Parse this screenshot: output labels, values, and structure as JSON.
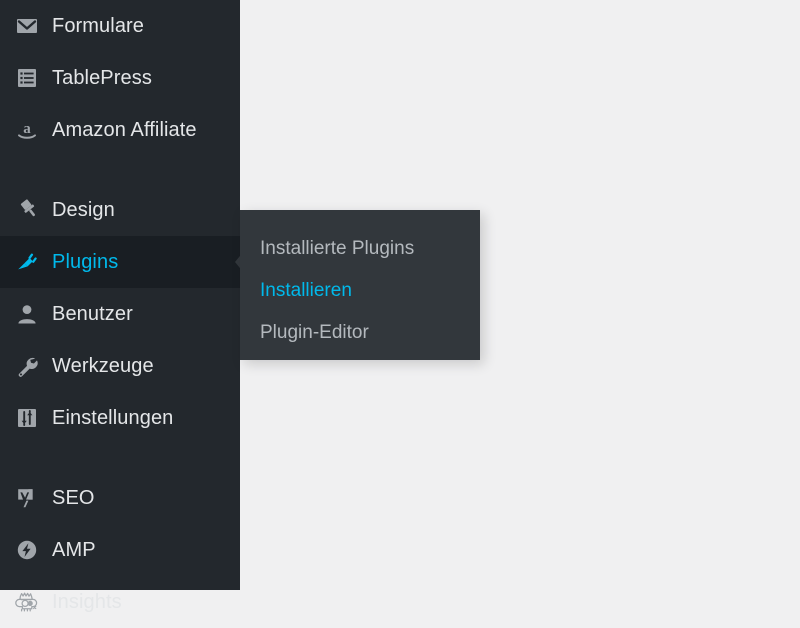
{
  "colors": {
    "sidebar_bg": "#23282d",
    "sidebar_active_bg": "#191e23",
    "submenu_bg": "#32373c",
    "content_bg": "#f0f0f1",
    "accent_cyan": "#00b9eb",
    "label_text": "#e4e6e8",
    "submenu_text": "#b4b9be",
    "icon_gray": "#a0a5aa"
  },
  "sidebar": {
    "groups": [
      {
        "items": [
          {
            "label": "Formulare",
            "icon": "envelope-icon",
            "current": false
          },
          {
            "label": "TablePress",
            "icon": "table-list-icon",
            "current": false
          },
          {
            "label": "Amazon Affiliate",
            "icon": "amazon-a-icon",
            "current": false
          }
        ]
      },
      {
        "items": [
          {
            "label": "Design",
            "icon": "paintbrush-icon",
            "current": false
          },
          {
            "label": "Plugins",
            "icon": "plug-icon",
            "current": true
          },
          {
            "label": "Benutzer",
            "icon": "user-icon",
            "current": false
          },
          {
            "label": "Werkzeuge",
            "icon": "wrench-icon",
            "current": false
          },
          {
            "label": "Einstellungen",
            "icon": "sliders-icon",
            "current": false
          }
        ]
      },
      {
        "items": [
          {
            "label": "SEO",
            "icon": "yoast-y-icon",
            "current": false
          },
          {
            "label": "AMP",
            "icon": "amp-bolt-icon",
            "current": false
          },
          {
            "label": "Insights",
            "icon": "monsterinsights-icon",
            "current": false
          }
        ]
      }
    ]
  },
  "submenu": {
    "parent": "Plugins",
    "items": [
      {
        "label": "Installierte Plugins",
        "current": false
      },
      {
        "label": "Installieren",
        "current": true
      },
      {
        "label": "Plugin-Editor",
        "current": false
      }
    ]
  }
}
